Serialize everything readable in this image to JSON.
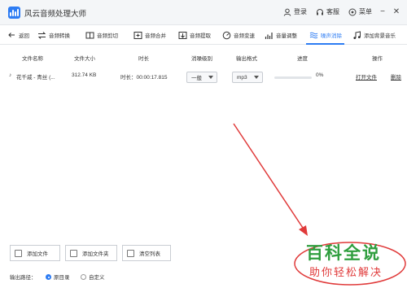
{
  "app": {
    "title": "风云音频处理大师"
  },
  "titlebar": {
    "login": "登录",
    "service": "客服",
    "menu": "菜单"
  },
  "toolbar": {
    "items": [
      {
        "label": "返回",
        "icon": "back-arrow-icon"
      },
      {
        "label": "音频转换",
        "icon": "audio-convert-icon"
      },
      {
        "label": "音频剪切",
        "icon": "audio-cut-icon"
      },
      {
        "label": "音频合并",
        "icon": "audio-merge-icon"
      },
      {
        "label": "音频提取",
        "icon": "audio-extract-icon"
      },
      {
        "label": "音频变速",
        "icon": "audio-speed-icon"
      },
      {
        "label": "音量调整",
        "icon": "volume-adjust-icon"
      },
      {
        "label": "噪声消除",
        "icon": "noise-remove-icon",
        "active": true
      },
      {
        "label": "添加背景音乐",
        "icon": "music-note-icon"
      }
    ]
  },
  "table": {
    "headers": {
      "name": "文件名称",
      "size": "文件大小",
      "duration": "时长",
      "level": "消噪级别",
      "format": "输出格式",
      "progress": "进度",
      "action": "操作"
    },
    "rows": [
      {
        "name": "花千戚 - 青丝 (...",
        "size": "312.74 KB",
        "duration": "时长：00:00:17.815",
        "level": "一般",
        "format": "mp3",
        "progress_text": "0%",
        "progress": 0.0,
        "open": "打开文件",
        "delete": "删除"
      }
    ]
  },
  "bottom": {
    "add_file": "添加文件",
    "add_folder": "添加文件夹",
    "clear_list": "清空列表",
    "output_path_label": "输出路径：",
    "option_original": "原目录",
    "option_custom": "自定义"
  },
  "watermark": {
    "title": "百科全说",
    "subtitle": "助你轻松解决"
  },
  "colors": {
    "accent": "#2d7cf3",
    "arrow": "#e03a3a",
    "watermark_green": "#2f9e3e",
    "watermark_red": "#e03a3a"
  }
}
